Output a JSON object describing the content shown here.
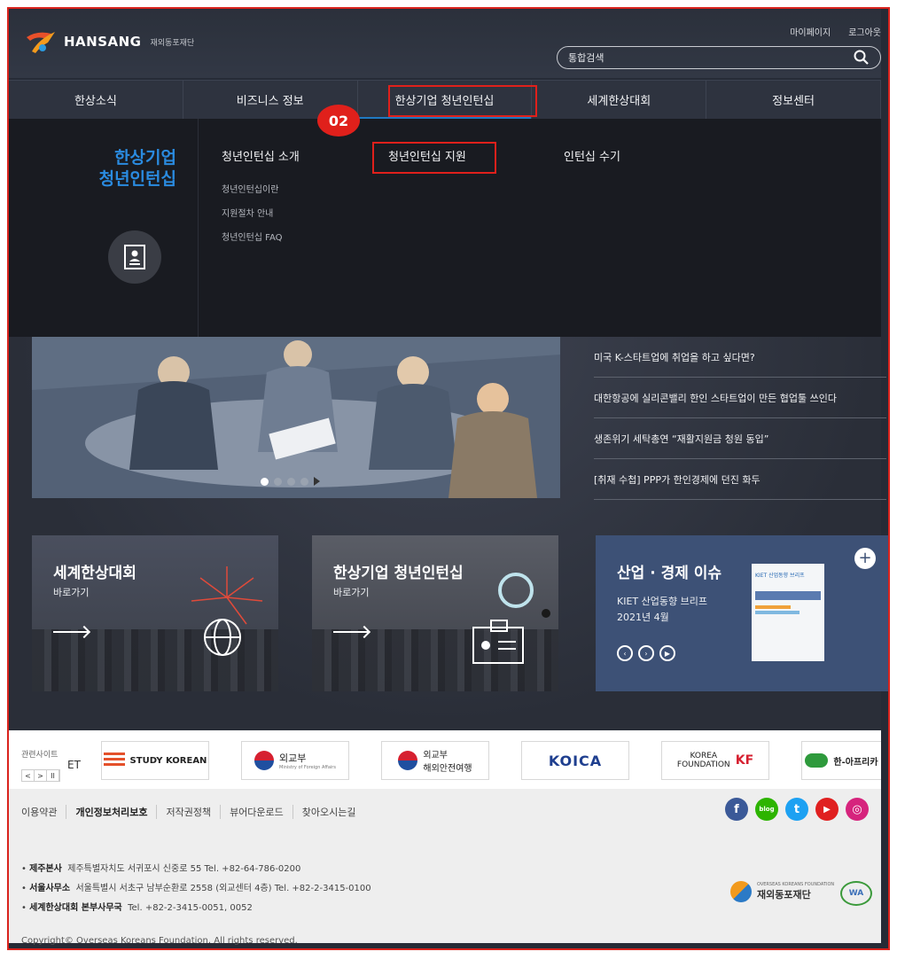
{
  "header": {
    "logo_text": "HANSANG",
    "logo_sub": "재외동포재단",
    "util_links": [
      "마이페이지",
      "로그아웃"
    ],
    "search_placeholder": "통합검색"
  },
  "nav": {
    "items": [
      "한상소식",
      "비즈니스 정보",
      "한상기업 청년인턴십",
      "세계한상대회",
      "정보센터"
    ],
    "active_index": 2
  },
  "annotation": {
    "badge": "02",
    "color": "#e0201b"
  },
  "mega": {
    "title_line1": "한상기업",
    "title_line2": "청년인턴십",
    "icon": "id-card-icon",
    "columns": [
      {
        "head": "청년인턴십 소개",
        "subs": [
          "청년인턴십이란",
          "지원절차 안내",
          "청년인턴십 FAQ"
        ]
      },
      {
        "head": "청년인턴십 지원",
        "subs": []
      },
      {
        "head": "인턴십 수기",
        "subs": []
      }
    ]
  },
  "news": [
    "미국 K-스타트업에 취업을 하고 싶다면?",
    "대한항공에 실리콘밸리 한인 스타트업이 만든 협업툴 쓰인다",
    "생존위기 세탁총연 “재활지원금 청원 동입”",
    "[취재 수첩] PPP가 한인경제에 던진 화두"
  ],
  "cards": [
    {
      "title": "세계한상대회",
      "sub": "바로가기"
    },
    {
      "title": "한상기업 청년인턴십",
      "sub": "바로가기"
    },
    {
      "title": "산업 · 경제 이슈",
      "line1": "KIET 산업동향 브리프",
      "line2": "2021년 4월",
      "brief_title": "KIET 산업동향 브리프",
      "plus": "+"
    }
  ],
  "related": {
    "label": "관련사이트",
    "controls": [
      "<",
      ">",
      "II"
    ],
    "sites": [
      {
        "name": "STUDY KOREAN"
      },
      {
        "name": "외교부",
        "sub": "Ministry of Foreign Affairs"
      },
      {
        "name": "외교부",
        "sub": "해외안전여행"
      },
      {
        "name": "KOICA"
      },
      {
        "name": "KOREA FOUNDATION"
      },
      {
        "name": "한-아프리카"
      }
    ],
    "partial_site": "ET"
  },
  "footer": {
    "links": [
      "이용약관",
      "개인정보처리보호",
      "저작권정책",
      "뷰어다운로드",
      "찾아오시는길"
    ],
    "social": [
      "f",
      "blog",
      "t",
      "▶",
      "◎"
    ],
    "social_colors": [
      "#3b5998",
      "#2db400",
      "#1da1f2",
      "#e02020",
      "#d6247d"
    ],
    "addr": [
      {
        "label": "제주본사",
        "text": "제주특별자치도 서귀포시 신중로 55   Tel. +82-64-786-0200"
      },
      {
        "label": "서울사무소",
        "text": "서울특별시 서초구 남부순환로 2558 (외교센터 4층)   Tel. +82-2-3415-0100"
      },
      {
        "label": "세계한상대회 본부사무국",
        "text": "Tel. +82-2-3415-0051, 0052"
      }
    ],
    "copyright": "Copyright© Overseas Koreans Foundation. All rights reserved.",
    "okf_sub": "OVERSEAS KOREANS FOUNDATION",
    "okf_name": "재외동포재단",
    "wa_badge": "WA"
  }
}
